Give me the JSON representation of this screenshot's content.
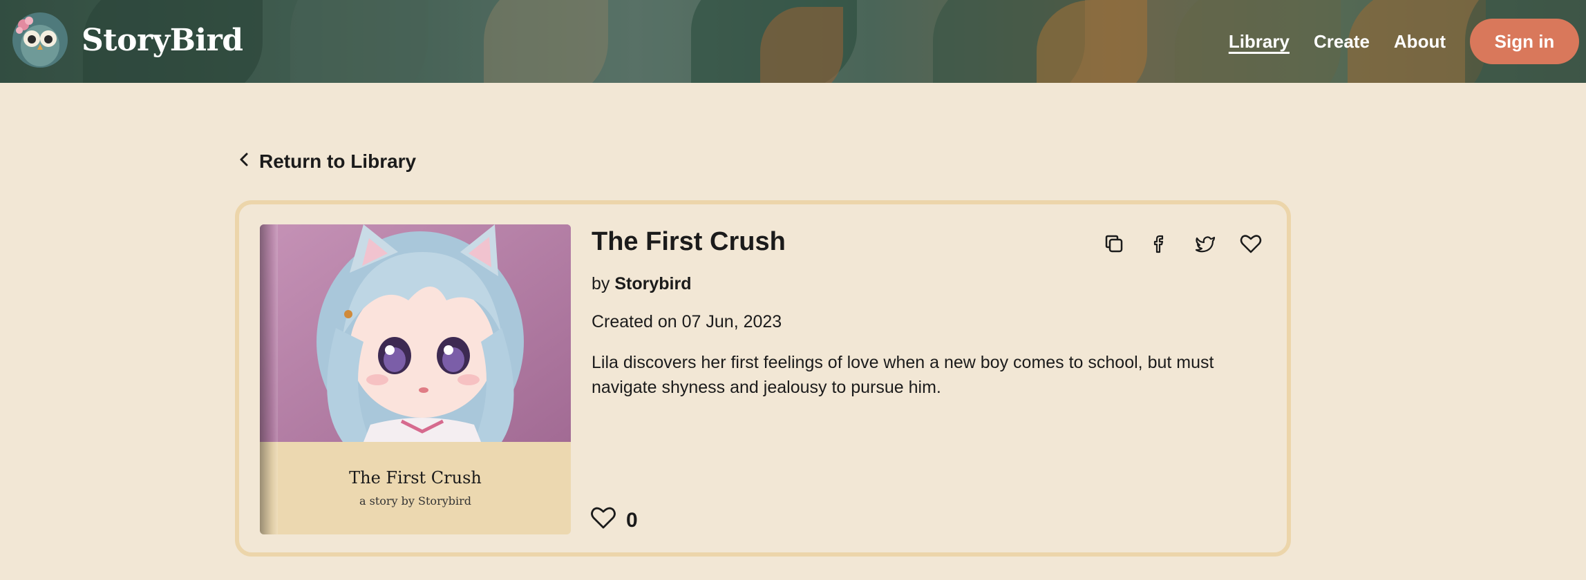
{
  "header": {
    "brand": "StoryBird",
    "nav": [
      {
        "label": "Library",
        "active": true
      },
      {
        "label": "Create",
        "active": false
      },
      {
        "label": "About",
        "active": false
      }
    ],
    "signin_label": "Sign in"
  },
  "back": {
    "label": "Return to Library",
    "icon": "chevron-left-icon"
  },
  "story": {
    "title": "The First Crush",
    "by_prefix": "by",
    "author": "Storybird",
    "created": "Created on 07 Jun, 2023",
    "description": "Lila discovers her first feelings of love when a new boy comes to school, but must navigate shyness and jealousy to pursue him.",
    "likes": "0",
    "cover": {
      "title": "The First Crush",
      "subtitle": "a story by Storybird"
    },
    "actions": [
      "copy-icon",
      "facebook-icon",
      "twitter-icon",
      "heart-icon"
    ]
  },
  "colors": {
    "background": "#f2e7d5",
    "accent": "#d9785b",
    "card_border": "#ecd5aa",
    "cover_label": "#ecd8b0"
  }
}
